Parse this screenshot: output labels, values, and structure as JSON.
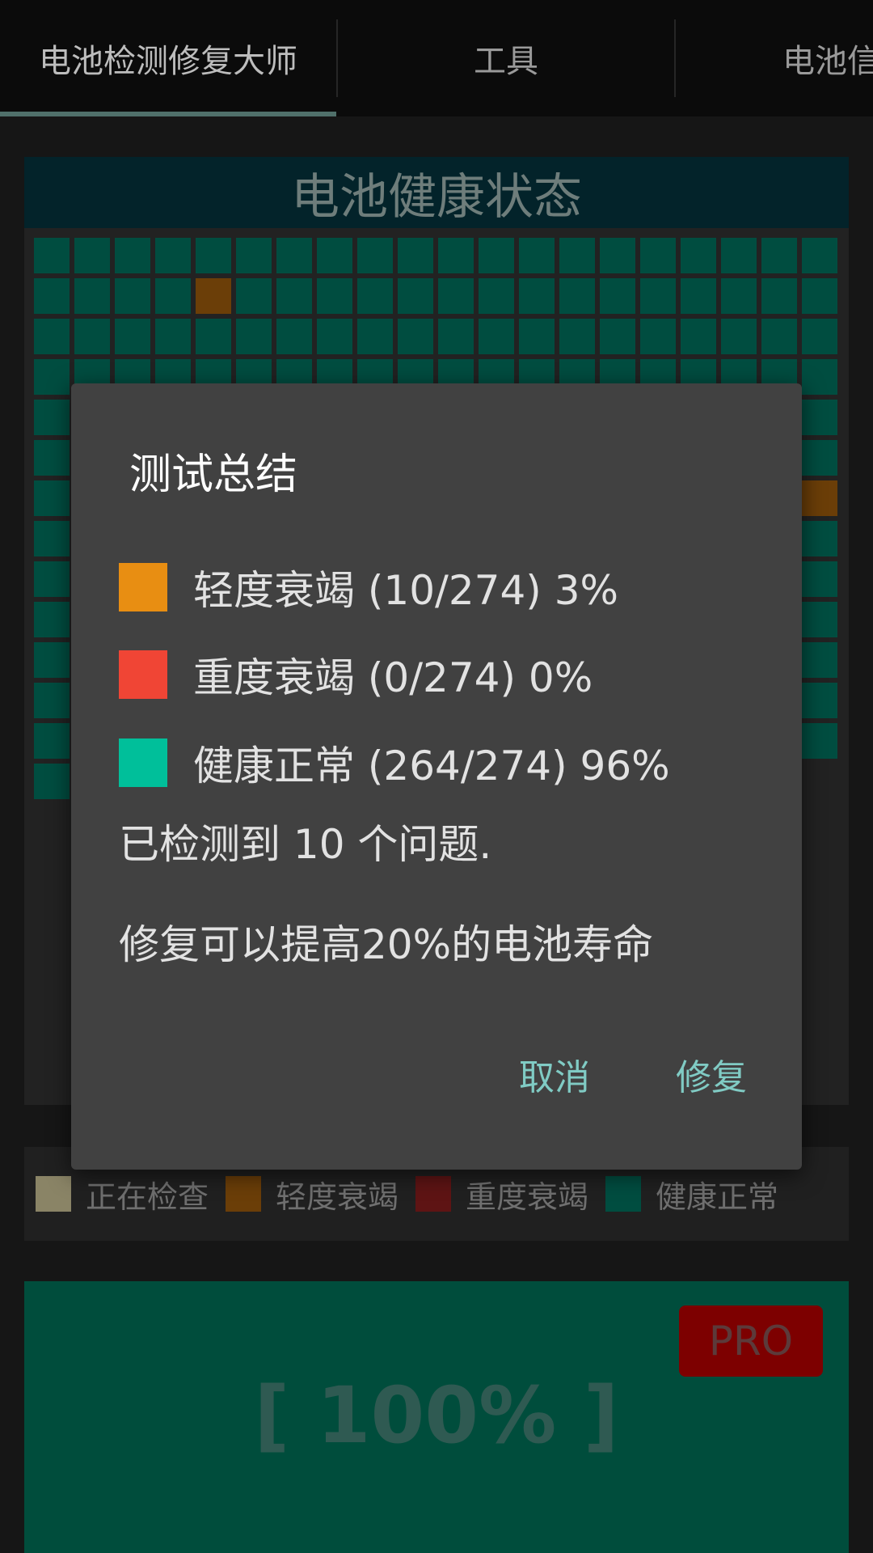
{
  "tabs": [
    "电池检测修复大师",
    "工具",
    "电池信"
  ],
  "health": {
    "header": "电池健康状态",
    "grid": {
      "columns": 20,
      "visible_rows": 14,
      "last_row_visible_cells": 1,
      "mild_cells": [
        [
          1,
          4
        ],
        [
          6,
          19
        ]
      ],
      "colors": {
        "healthy": "#004d40",
        "mild": "#6b3e08"
      }
    }
  },
  "legend": [
    {
      "label": "正在检查",
      "color": "#8a8466"
    },
    {
      "label": "轻度衰竭",
      "color": "#6b3e08"
    },
    {
      "label": "重度衰竭",
      "color": "#5e1414"
    },
    {
      "label": "健康正常",
      "color": "#004d40"
    }
  ],
  "percent_panel": {
    "pro_label": "PRO",
    "percent": "[ 100% ]"
  },
  "dialog": {
    "title": "测试总结",
    "summary": [
      {
        "text": "轻度衰竭 (10/274)  3%",
        "color": "#e88e12"
      },
      {
        "text": "重度衰竭 (0/274)  0%",
        "color": "#f04535"
      },
      {
        "text": "健康正常 (264/274)  96%",
        "color": "#00bf9a"
      }
    ],
    "detected": "已检测到 10 个问题.",
    "tip": "修复可以提高20%的电池寿命",
    "cancel": "取消",
    "repair": "修复"
  }
}
